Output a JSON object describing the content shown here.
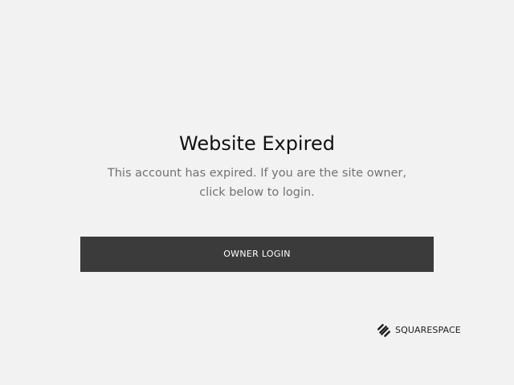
{
  "page": {
    "title": "Website Expired",
    "message": "This account has expired. If you are the site owner, click below to login.",
    "login_button_label": "OWNER LOGIN"
  },
  "brand": {
    "name": "SQUARESPACE",
    "icon": "squarespace-logo-icon"
  },
  "colors": {
    "background": "#f2f2f2",
    "button_background": "#3b3b3b",
    "button_text": "#ffffff",
    "title_text": "#111111",
    "message_text": "#727272"
  }
}
